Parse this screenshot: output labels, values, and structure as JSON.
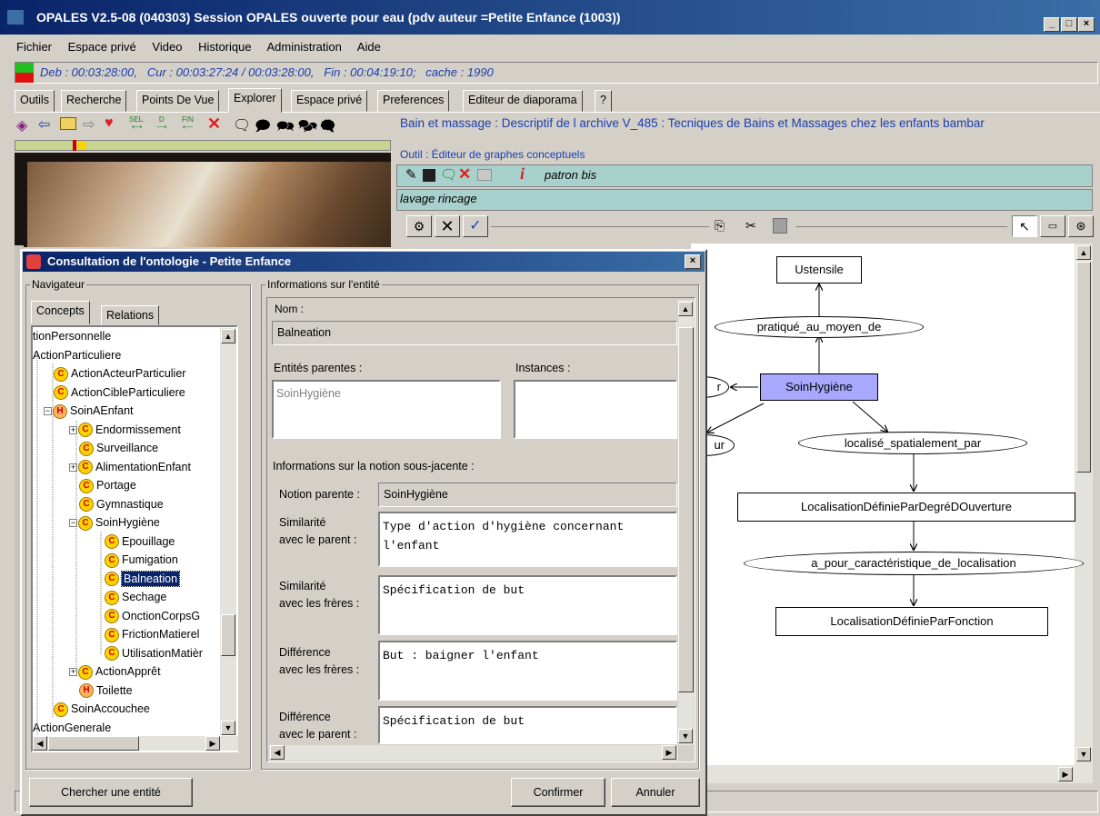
{
  "app": {
    "title": "OPALES V2.5-08 (040303)   Session OPALES ouverte pour eau (pdv auteur =Petite Enfance (1003))"
  },
  "menu": [
    "Fichier",
    "Espace privé",
    "Video",
    "Historique",
    "Administration",
    "Aide"
  ],
  "status": {
    "deb": "Deb : 00:03:28:00,",
    "cur": "Cur : 00:03:27:24 / 00:03:28:00,",
    "fin": "Fin : 00:04:19:10;",
    "cache": "cache :  1990"
  },
  "tabs": [
    "Outils",
    "Recherche",
    "Points De Vue",
    "Explorer",
    "Espace privé",
    "Preferences",
    "Editeur de diaporama",
    "?"
  ],
  "active_tab": "Explorer",
  "toolbar": {
    "sel_label": "SEL.",
    "d_label": "D",
    "fin_label": "FIN"
  },
  "archive_title": "Bain et massage : Descriptif de l archive V_485 : Tecniques de Bains et Massages chez les enfants bambar",
  "graph_tool": {
    "tool_label": "Outil :  Éditeur de graphes conceptuels",
    "pattern_name": "patron bis",
    "subtitle": "lavage rincage"
  },
  "graph": {
    "nodes": {
      "ustensile": "Ustensile",
      "pratique": "pratiqué_au_moyen_de",
      "soin": "SoinHygiène",
      "left_top": "r",
      "left_bottom": "ur",
      "localise": "localisé_spatialement_par",
      "loc_degre": "LocalisationDéfinieParDegréDOuverture",
      "a_pour": "a_pour_caractéristique_de_localisation",
      "loc_fonction": "LocalisationDéfinieParFonction"
    }
  },
  "dialog": {
    "title": "Consultation de l'ontologie - Petite Enfance",
    "close": "×",
    "navigator_label": "Navigateur",
    "nav_tabs": [
      "Concepts",
      "Relations"
    ],
    "tree": [
      {
        "label": "tionPersonnelle",
        "type": "none",
        "indent": 0
      },
      {
        "label": "ActionParticuliere",
        "type": "none",
        "indent": 0
      },
      {
        "label": "ActionActeurParticulier",
        "type": "C",
        "indent": 1
      },
      {
        "label": "ActionCibleParticuliere",
        "type": "C",
        "indent": 1
      },
      {
        "label": "SoinAEnfant",
        "type": "H",
        "indent": 1,
        "expander": "−"
      },
      {
        "label": "Endormissement",
        "type": "C",
        "indent": 2,
        "expander": "+"
      },
      {
        "label": "Surveillance",
        "type": "C",
        "indent": 2
      },
      {
        "label": "AlimentationEnfant",
        "type": "C",
        "indent": 2,
        "expander": "+"
      },
      {
        "label": "Portage",
        "type": "C",
        "indent": 2
      },
      {
        "label": "Gymnastique",
        "type": "C",
        "indent": 2
      },
      {
        "label": "SoinHygiène",
        "type": "C",
        "indent": 2,
        "expander": "−"
      },
      {
        "label": "Epouillage",
        "type": "C",
        "indent": 3
      },
      {
        "label": "Fumigation",
        "type": "C",
        "indent": 3
      },
      {
        "label": "Balneation",
        "type": "C",
        "indent": 3,
        "selected": true
      },
      {
        "label": "Sechage",
        "type": "C",
        "indent": 3
      },
      {
        "label": "OnctionCorpsG",
        "type": "C",
        "indent": 3
      },
      {
        "label": "FrictionMatierel",
        "type": "C",
        "indent": 3
      },
      {
        "label": "UtilisationMatièr",
        "type": "C",
        "indent": 3
      },
      {
        "label": "ActionApprêt",
        "type": "C",
        "indent": 2,
        "expander": "+"
      },
      {
        "label": "Toilette",
        "type": "H",
        "indent": 2
      },
      {
        "label": "SoinAccouchee",
        "type": "C",
        "indent": 1
      },
      {
        "label": "ActionGenerale",
        "type": "none",
        "indent": 0
      }
    ],
    "info_label": "Informations sur l'entité",
    "nom_label": "Nom :",
    "nom_value": "Balneation",
    "parents_label": "Entités parentes :",
    "instances_label": "Instances :",
    "parents_value": "SoinHygiène",
    "notion_label": "Informations sur la notion sous-jacente :",
    "notion_parente_label": "Notion parente :",
    "notion_parente_value": "SoinHygiène",
    "sim_parent_label_1": "Similarité",
    "sim_parent_label_2": "avec le parent :",
    "sim_parent_value": "Type d'action d'hygiène concernant l'enfant",
    "sim_freres_label_1": "Similarité",
    "sim_freres_label_2": "avec les frères :",
    "sim_freres_value": "Spécification de but",
    "diff_freres_label_1": "Différence",
    "diff_freres_label_2": "avec les frères :",
    "diff_freres_value": "But : baigner l'enfant",
    "diff_parent_label_1": "Différence",
    "diff_parent_label_2": "avec le parent :",
    "diff_parent_value": "Spécification de but",
    "search_button": "Chercher une entité",
    "confirm_button": "Confirmer",
    "cancel_button": "Annuler"
  }
}
